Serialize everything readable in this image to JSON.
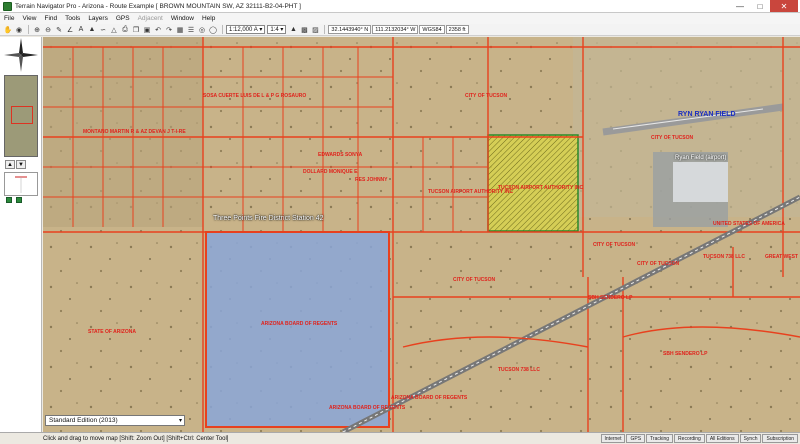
{
  "window": {
    "title": "Terrain Navigator Pro - Arizona - Route Example [ BROWN MOUNTAIN SW, AZ 32111-B2-04-PHT ]",
    "controls": [
      "minimize",
      "maximize",
      "close"
    ]
  },
  "menu": [
    {
      "label": "File"
    },
    {
      "label": "View"
    },
    {
      "label": "Find"
    },
    {
      "label": "Tools"
    },
    {
      "label": "Layers"
    },
    {
      "label": "GPS"
    },
    {
      "label": "Adjacent",
      "disabled": true
    },
    {
      "label": "Window"
    },
    {
      "label": "Help"
    }
  ],
  "toolbar": {
    "scale": "1:12,000 A",
    "ratio": "1:4",
    "lat": "32.1443940° N",
    "lon": "111.2132034° W",
    "datum": "WGS84",
    "elev": "2358 ft"
  },
  "map_labels": {
    "ryan_field": "RYN RYAN FIELD",
    "ryan_field_airport": "Ryan Field (airport)",
    "fire_station": "Three Points Fire District Station 42",
    "city_tucson_1": "CITY OF TUCSON",
    "city_tucson_2": "CITY OF TUCSON",
    "city_tucson_3": "CITY OF TUCSON",
    "city_tucson_4": "CITY OF TUCSON",
    "city_tucson_5": "CITY OF TUCSON",
    "tucson_airport_auth_1": "TUCSON AIRPORT AUTHORITY INC",
    "tucson_airport_auth_2": "TUCSON AIRPORT AUTHORITY INC",
    "tucson_738_1": "TUCSON 738 LLC",
    "tucson_738_2": "TUCSON 738 LLC",
    "state_arizona": "STATE OF ARIZONA",
    "az_regents_1": "ARIZONA BOARD OF REGENTS",
    "az_regents_2": "ARIZONA BOARD OF REGENTS",
    "az_regents_3": "ARIZONA BOARD OF REGENTS",
    "usa": "UNITED STATES OF AMERICA",
    "great_west": "GREAT WEST",
    "sbh_sendero_1": "SBH SENDERO LP",
    "sbh_sendero_2": "SBH SENDERO LP",
    "edwards": "EDWARDS SONYA",
    "dollard": "DOLLARD MONIQUE E",
    "res_johnny": "RES JOHNNY",
    "montano": "MONTANO MARTIN R & AZ DEVAN J T-I-RE",
    "sosa": "SOSA CUERTE LUIS DE L & P G ROSAURO"
  },
  "edition": {
    "selected": "Standard Edition (2013)"
  },
  "status": {
    "message": "Click and drag to move map [Shift: Zoom Out] [Shift+Ctrl: Center Tool]",
    "indicators": [
      "Internet",
      "GPS",
      "Tracking",
      "Recording",
      "All Editions",
      "Synch",
      "Subscription"
    ]
  },
  "colors": {
    "parcel_line": "#e8411e",
    "regents_fill": "#8aa6d8",
    "airport_fill": "#d8d54a",
    "terrain": "#c9b48a"
  }
}
